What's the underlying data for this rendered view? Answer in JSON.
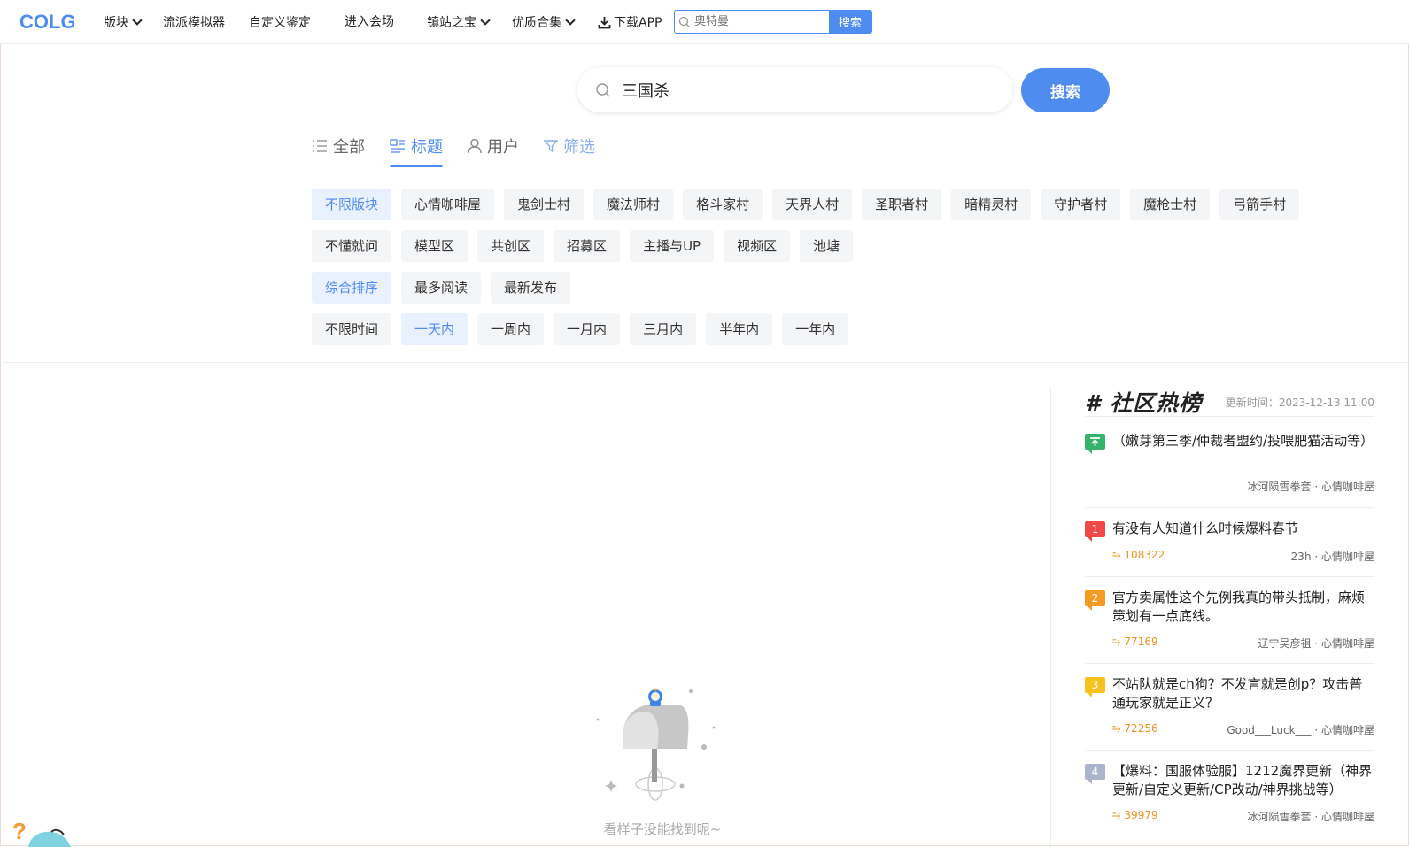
{
  "nav": {
    "logo": "COLG",
    "items": [
      {
        "label": "版块",
        "dropdown": true
      },
      {
        "label": "流派模拟器",
        "dropdown": false
      },
      {
        "label": "自定义鉴定",
        "dropdown": false
      },
      {
        "label": "进入会场",
        "dropdown": false
      },
      {
        "label": "镇站之宝",
        "dropdown": true
      },
      {
        "label": "优质合集",
        "dropdown": true
      }
    ],
    "download_label": "下载APP",
    "search_placeholder": "奥特曼",
    "search_button": "搜索"
  },
  "search": {
    "query": "三国杀",
    "button": "搜索"
  },
  "tabs": [
    {
      "label": "全部",
      "icon": "list-icon"
    },
    {
      "label": "标题",
      "icon": "title-icon",
      "active": true
    },
    {
      "label": "用户",
      "icon": "user-icon"
    },
    {
      "label": "筛选",
      "icon": "filter-icon"
    }
  ],
  "filters": {
    "sections": [
      "不限版块",
      "心情咖啡屋",
      "鬼剑士村",
      "魔法师村",
      "格斗家村",
      "天界人村",
      "圣职者村",
      "暗精灵村",
      "守护者村",
      "魔枪士村",
      "弓箭手村"
    ],
    "sections2": [
      "不懂就问",
      "模型区",
      "共创区",
      "招募区",
      "主播与UP",
      "视频区",
      "池塘"
    ],
    "sort": [
      "综合排序",
      "最多阅读",
      "最新发布"
    ],
    "time": [
      "不限时间",
      "一天内",
      "一周内",
      "一月内",
      "三月内",
      "半年内",
      "一年内"
    ]
  },
  "empty_text": "看样子没能找到呢~",
  "sidebar": {
    "title": "# 社区热榜",
    "updated_label": "更新时间：",
    "updated_time": "2023-12-13 11:00",
    "items": [
      {
        "badge": "",
        "title": "（嫩芽第三季/仲裁者盟约/投喂肥猫活动等）",
        "heat": "",
        "meta": "冰河陨雪拳套 · 心情咖啡屋",
        "color": "#33b36b"
      },
      {
        "badge": "1",
        "title": "有没有人知道什么时候爆料春节",
        "heat": "108322",
        "meta": "23h · 心情咖啡屋",
        "color": "#f04848"
      },
      {
        "badge": "2",
        "title": "官方卖属性这个先例我真的带头抵制，麻烦策划有一点底线。",
        "heat": "77169",
        "meta": "辽宁吴彦祖 · 心情咖啡屋",
        "color": "#f59a23"
      },
      {
        "badge": "3",
        "title": "不站队就是ch狗？不发言就是创p？攻击普通玩家就是正义？",
        "heat": "72256",
        "meta": "Good___Luck___ · 心情咖啡屋",
        "color": "#f7c21e"
      },
      {
        "badge": "4",
        "title": "【爆料：国服体验服】1212魔界更新（神界更新/自定义更新/CP改动/神界挑战等）",
        "heat": "39979",
        "meta": "冰河陨雪拳套 · 心情咖啡屋",
        "color": "#aab4cc"
      }
    ]
  }
}
